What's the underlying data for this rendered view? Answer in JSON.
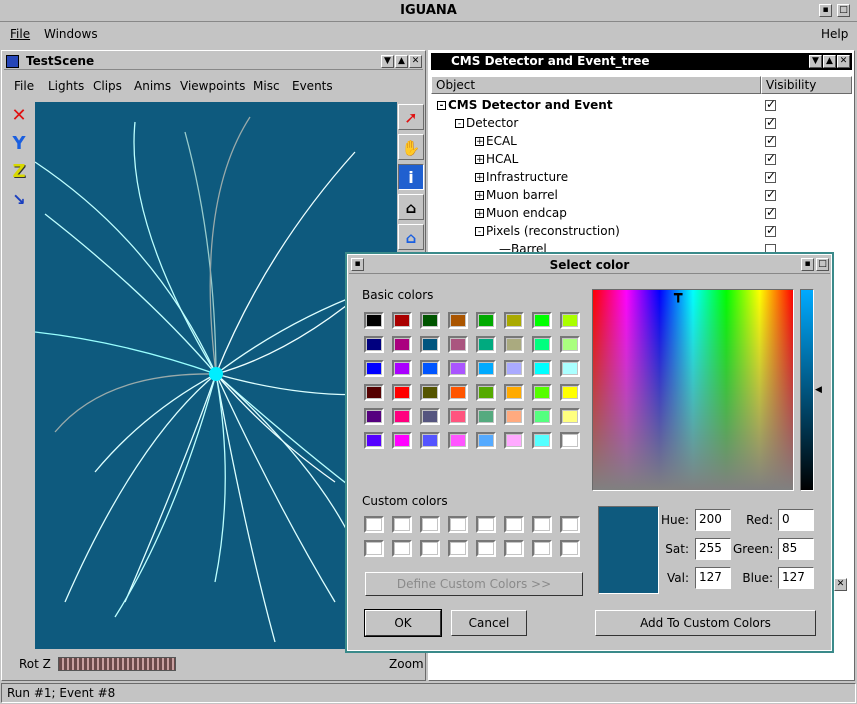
{
  "app": {
    "title": "IGUANA"
  },
  "menubar": {
    "file": "File",
    "windows": "Windows",
    "help": "Help"
  },
  "scene": {
    "title": "TestScene",
    "menu": [
      "File",
      "Lights",
      "Clips",
      "Anims",
      "Viewpoints",
      "Misc",
      "Events"
    ],
    "rot_label": "Rot Z",
    "zoom_label": "Zoom",
    "bg_color": "#0e5a7e",
    "left_tools": [
      "x-axis-icon",
      "y-axis-icon",
      "z-axis-icon",
      "seek-arrow-icon"
    ],
    "right_tools": [
      "select-arrow-icon",
      "hand-icon",
      "info-icon",
      "home-icon",
      "set-home-icon"
    ]
  },
  "tree": {
    "title": "CMS Detector and Event_tree",
    "col_object": "Object",
    "col_visibility": "Visibility",
    "rows": [
      {
        "label": "CMS Detector and Event",
        "checked": true
      },
      {
        "label": "Detector",
        "checked": true
      },
      {
        "label": "ECAL",
        "checked": true
      },
      {
        "label": "HCAL",
        "checked": true
      },
      {
        "label": "Infrastructure",
        "checked": true
      },
      {
        "label": "Muon barrel",
        "checked": true
      },
      {
        "label": "Muon endcap",
        "checked": true
      },
      {
        "label": "Pixels (reconstruction)",
        "checked": true
      },
      {
        "label": "Barrel",
        "checked": false
      }
    ]
  },
  "dialog": {
    "title": "Select color",
    "basic_colors_label": "Basic colors",
    "custom_colors_label": "Custom colors",
    "define_custom": "Define Custom Colors >>",
    "ok": "OK",
    "cancel": "Cancel",
    "add_custom": "Add To Custom Colors",
    "current_color": "#0e5a7e",
    "fields": {
      "hue_label": "Hue:",
      "hue": "200",
      "sat_label": "Sat:",
      "sat": "255",
      "val_label": "Val:",
      "val": "127",
      "red_label": "Red:",
      "red": "0",
      "green_label": "Green:",
      "green": "85",
      "blue_label": "Blue:",
      "blue": "127"
    },
    "basic_colors": [
      "#000000",
      "#aa0000",
      "#005500",
      "#aa5500",
      "#00aa00",
      "#aaaa00",
      "#00ff00",
      "#aaff00",
      "#00007f",
      "#aa007f",
      "#00557f",
      "#aa557f",
      "#00aa7f",
      "#aaaa7f",
      "#00ff7f",
      "#aaff7f",
      "#0000ff",
      "#aa00ff",
      "#0055ff",
      "#aa55ff",
      "#00aaff",
      "#aaaaff",
      "#00ffff",
      "#aaffff",
      "#550000",
      "#ff0000",
      "#555500",
      "#ff5500",
      "#55aa00",
      "#ffaa00",
      "#55ff00",
      "#ffff00",
      "#55007f",
      "#ff007f",
      "#55557f",
      "#ff557f",
      "#55aa7f",
      "#ffaa7f",
      "#55ff7f",
      "#ffff7f",
      "#5500ff",
      "#ff00ff",
      "#5555ff",
      "#ff55ff",
      "#55aaff",
      "#ffaaff",
      "#55ffff",
      "#ffffff"
    ]
  },
  "status": {
    "text": "Run #1; Event #8"
  }
}
